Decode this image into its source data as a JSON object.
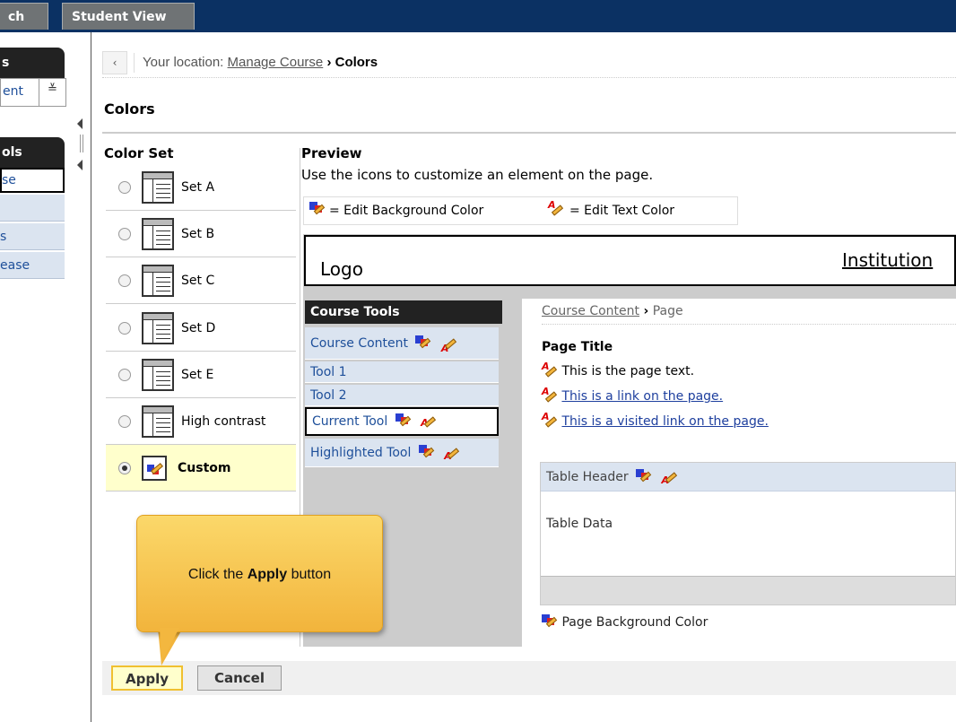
{
  "tabs": [
    {
      "label": "ch"
    },
    {
      "label": "Student View"
    }
  ],
  "left_panel": {
    "box1_title": "s",
    "box1_select": "ent",
    "box2_title": "ols",
    "items": [
      "se",
      "s",
      "ease"
    ]
  },
  "breadcrumb": {
    "prefix": "Your location:",
    "link": "Manage Course",
    "separator": "›",
    "current": "Colors"
  },
  "page_title": "Colors",
  "color_set": {
    "label": "Color Set",
    "options": [
      {
        "label": "Set A",
        "selected": false
      },
      {
        "label": "Set B",
        "selected": false
      },
      {
        "label": "Set C",
        "selected": false
      },
      {
        "label": "Set D",
        "selected": false
      },
      {
        "label": "Set E",
        "selected": false
      },
      {
        "label": "High contrast",
        "selected": false
      },
      {
        "label": "Custom",
        "selected": true
      }
    ]
  },
  "preview": {
    "label": "Preview",
    "description": "Use the icons to customize an element on the page.",
    "legend_bg": "= Edit Background Color",
    "legend_text": "= Edit Text Color",
    "logo": "Logo",
    "institution": "Institution",
    "course_tools_title": "Course Tools",
    "course_tools": [
      "Course Content",
      "Tool 1",
      "Tool 2",
      "Current Tool",
      "Highlighted Tool"
    ],
    "crumb_link": "Course Content",
    "crumb_sep": "›",
    "crumb_page": "Page",
    "page_title": "Page Title",
    "page_text": "This is the page text.",
    "link_text": "This is a link on the page.",
    "visited_link_text": "This is a visited link on the page.",
    "table_header": "Table Header",
    "table_data": "Table Data",
    "page_bg": "Page Background Color"
  },
  "buttons": {
    "apply": "Apply",
    "cancel": "Cancel"
  },
  "callout": {
    "pre": "Click the",
    "bold": "Apply",
    "post": "button"
  },
  "colors": {
    "topbar": "#0b3163",
    "link": "#1e4f9a",
    "highlight": "#ffffcc",
    "callout": "#f2b43c"
  }
}
